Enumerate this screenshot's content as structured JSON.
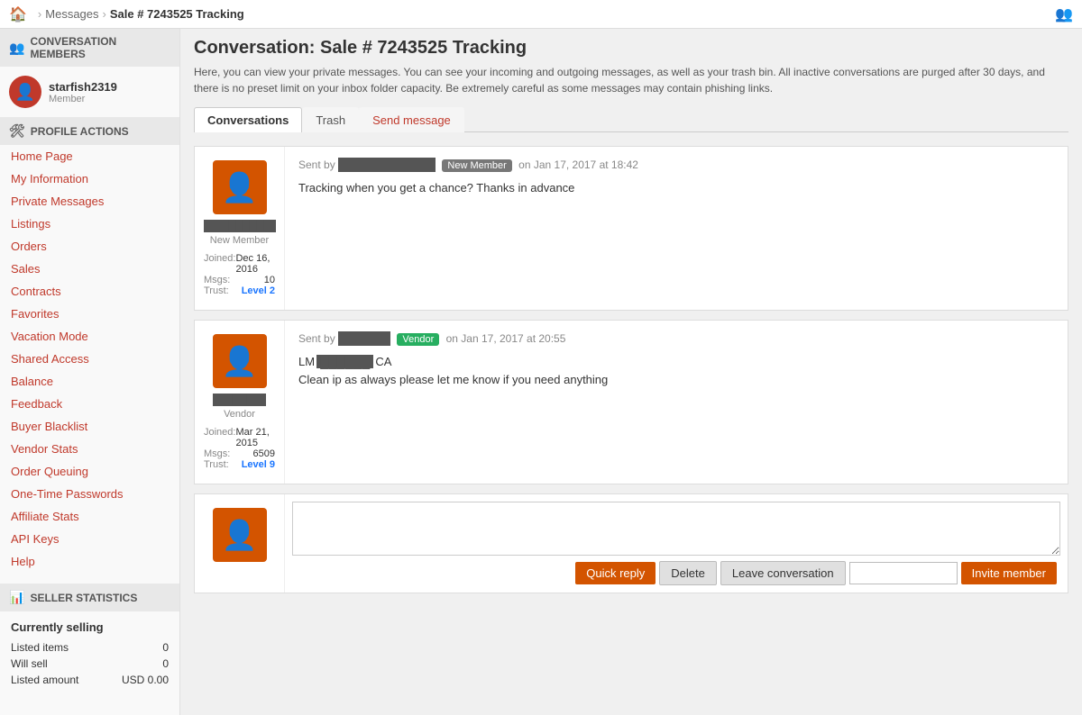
{
  "topnav": {
    "home_icon": "🏠",
    "breadcrumbs": [
      {
        "label": "Messages",
        "active": false
      },
      {
        "label": "Sale # 7243525 Tracking",
        "active": true
      }
    ],
    "network_icon": "👤"
  },
  "sidebar": {
    "conversation_members_header": "CONVERSATION MEMBERS",
    "user": {
      "username": "starfish2319",
      "role": "Member"
    },
    "profile_actions_header": "PROFILE ACTIONS",
    "nav_links": [
      "Home Page",
      "My Information",
      "Private Messages",
      "Listings",
      "Orders",
      "Sales",
      "Contracts",
      "Favorites",
      "Vacation Mode",
      "Shared Access",
      "Balance",
      "Feedback",
      "Buyer Blacklist",
      "Vendor Stats",
      "Order Queuing",
      "One-Time Passwords",
      "Affiliate Stats",
      "API Keys",
      "Help"
    ],
    "seller_stats_header": "SELLER STATISTICS",
    "currently_selling": "Currently selling",
    "stats": [
      {
        "label": "Listed items",
        "value": "0"
      },
      {
        "label": "Will sell",
        "value": "0"
      },
      {
        "label": "Listed amount",
        "value": "USD 0.00"
      }
    ]
  },
  "main": {
    "page_title": "Conversation: Sale # 7243525 Tracking",
    "info_text": "Here, you can view your private messages. You can see your incoming and outgoing messages, as well as your trash bin. All inactive conversations are purged after 30 days, and there is no preset limit on your inbox folder capacity. Be extremely careful as some messages may contain phishing links.",
    "tabs": [
      {
        "label": "Conversations",
        "active": true
      },
      {
        "label": "Trash",
        "active": false
      },
      {
        "label": "Send message",
        "active": false,
        "special": true
      }
    ],
    "messages": [
      {
        "avatar_icon": "👤",
        "username_redacted": true,
        "username_bar": "████████",
        "badge": "New Member",
        "badge_type": "new_member",
        "sent_label": "Sent by",
        "date": "on Jan 17, 2017 at 18:42",
        "body": "Tracking when you get a chance? Thanks in advance",
        "role": "New Member",
        "joined": "Dec 16, 2016",
        "msgs": "10",
        "trust": "Level 2",
        "trust_color": "#1a75ff"
      },
      {
        "avatar_icon": "👤",
        "username_redacted": true,
        "username_bar": "████",
        "badge": "Vendor",
        "badge_type": "vendor",
        "sent_label": "Sent by",
        "date": "on Jan 17, 2017 at 20:55",
        "body_prefix": "LM",
        "body_redacted": "██████",
        "body_suffix": "CA",
        "body_line2": "Clean ip as always please let me know if you need anything",
        "role": "Vendor",
        "joined": "Mar 21, 2015",
        "msgs": "6509",
        "trust": "Level 9",
        "trust_color": "#1a75ff"
      }
    ],
    "reply": {
      "placeholder": "",
      "buttons": {
        "quick_reply": "Quick reply",
        "delete": "Delete",
        "leave_conversation": "Leave conversation",
        "invite_placeholder": "",
        "invite_member": "Invite member"
      }
    }
  }
}
